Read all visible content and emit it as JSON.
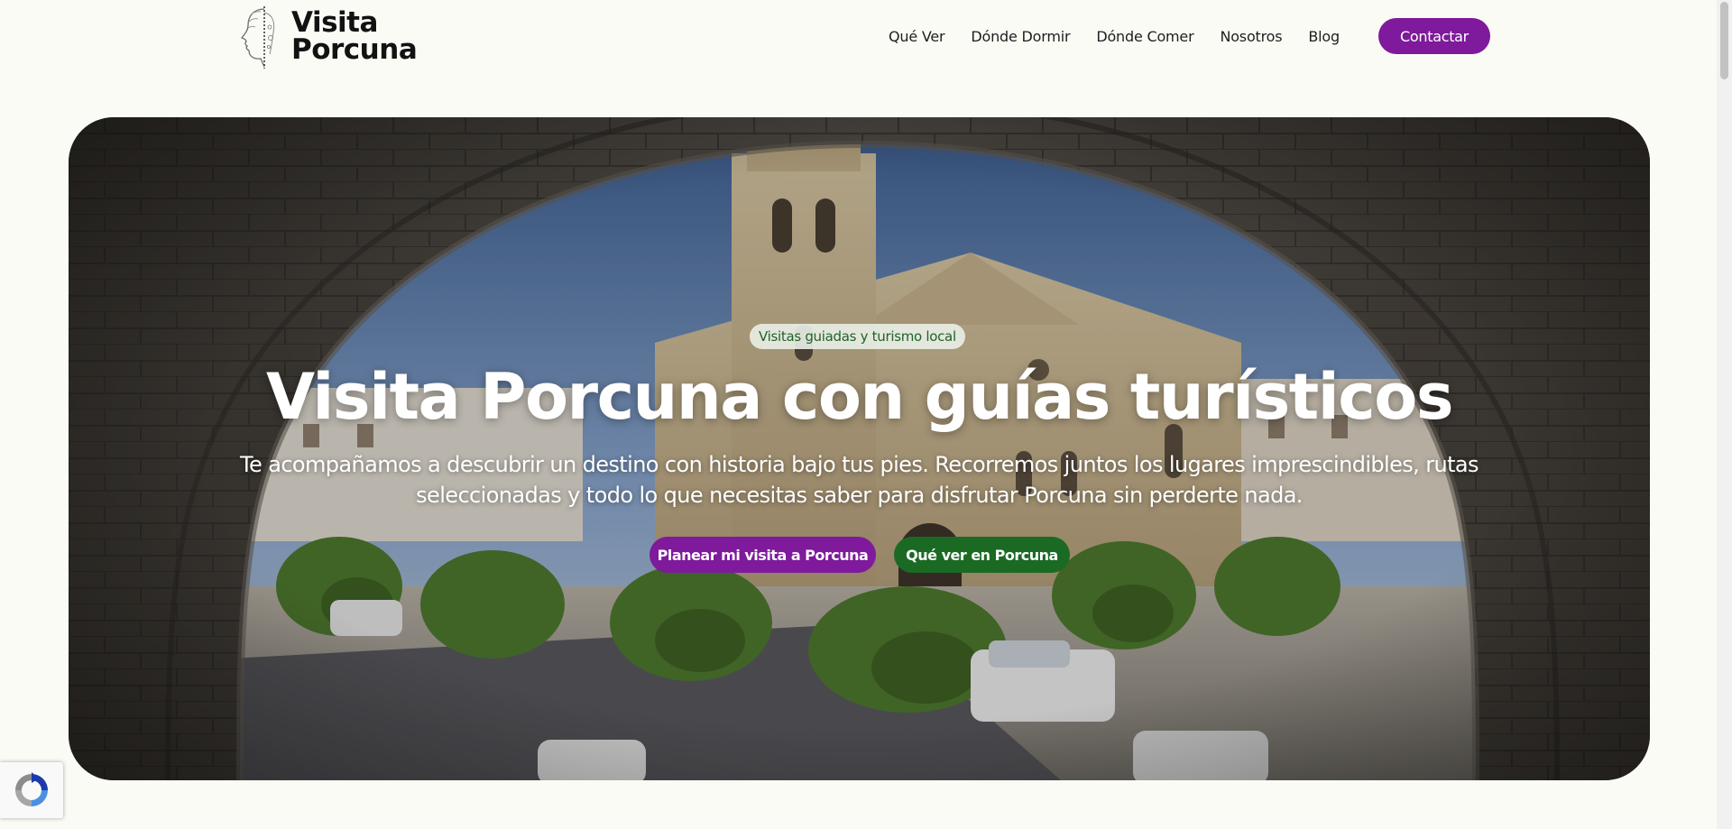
{
  "header": {
    "logo": {
      "line1": "Visita",
      "line2": "Porcuna"
    },
    "nav": [
      {
        "label": "Qué Ver"
      },
      {
        "label": "Dónde Dormir"
      },
      {
        "label": "Dónde Comer"
      },
      {
        "label": "Nosotros"
      },
      {
        "label": "Blog"
      }
    ],
    "contact_label": "Contactar"
  },
  "hero": {
    "badge": "Visitas guiadas y turismo local",
    "title": "Visita Porcuna con guías turísticos",
    "subtitle": "Te acompañamos a descubrir un destino con historia bajo tus pies. Recorremos juntos los lugares imprescindibles, rutas seleccionadas y todo lo que necesitas saber para disfrutar Porcuna sin perderte nada.",
    "primary_button": "Planear mi visita a Porcuna",
    "secondary_button": "Qué ver en Porcuna",
    "background_icon": "town-square-through-stone-arch-photo"
  },
  "recaptcha": {
    "icon": "recaptcha-icon"
  },
  "colors": {
    "page_background": "#fbfbf6",
    "brand_purple": "#7e1a9b",
    "brand_green": "#1b6a24",
    "badge_text": "#20632b",
    "badge_background": "#e8eee4"
  }
}
